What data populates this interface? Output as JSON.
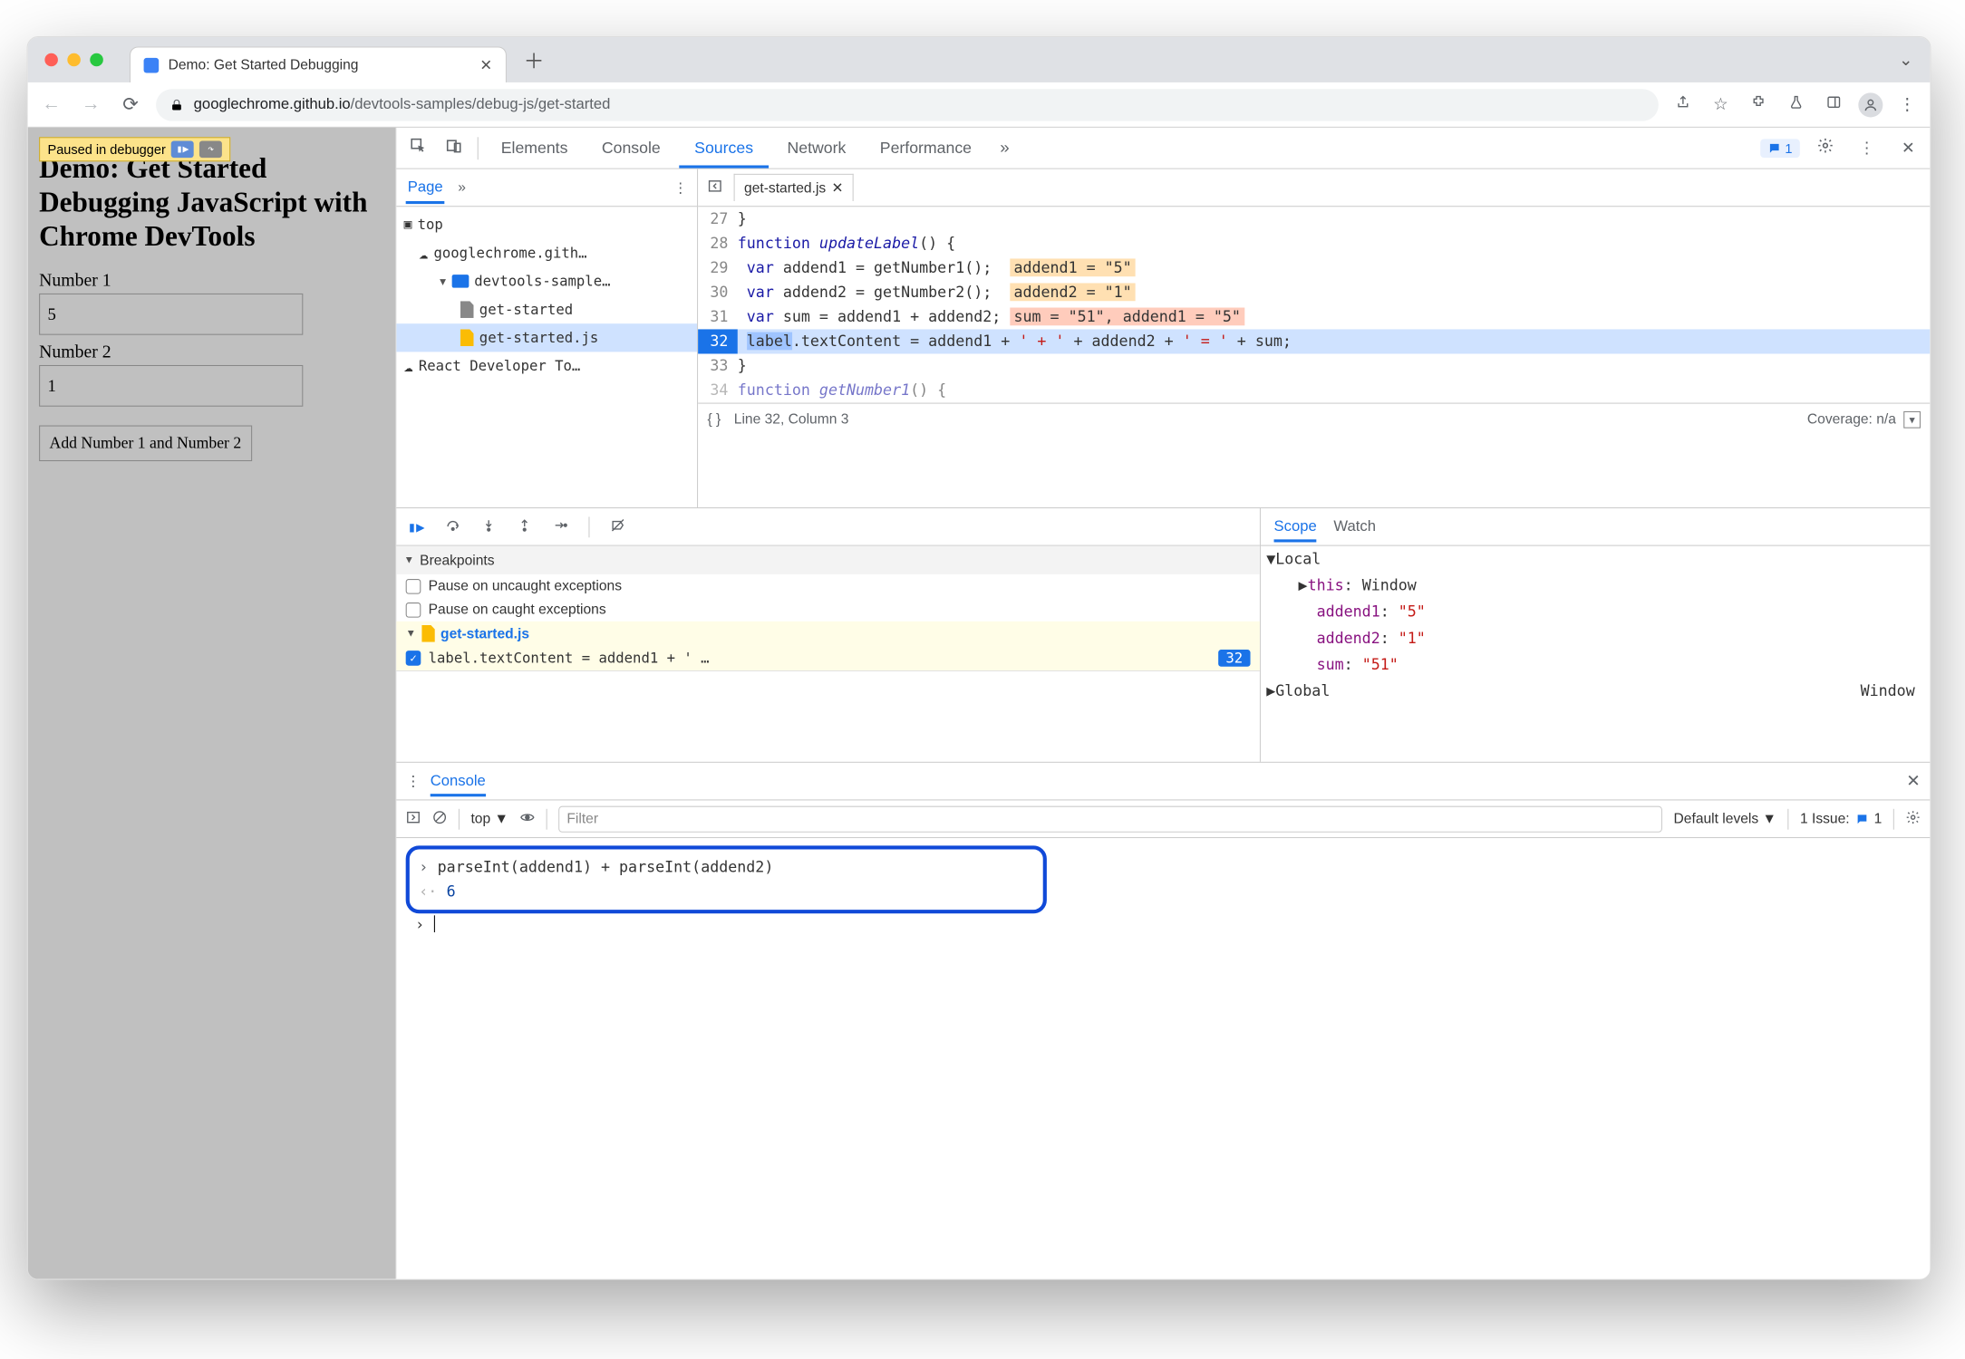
{
  "browser": {
    "tabTitle": "Demo: Get Started Debugging",
    "urlHost": "googlechrome.github.io",
    "urlPath": "/devtools-samples/debug-js/get-started"
  },
  "page": {
    "pausedText": "Paused in debugger",
    "heading": "Demo: Get Started Debugging JavaScript with Chrome DevTools",
    "num1Label": "Number 1",
    "num1Value": "5",
    "num2Label": "Number 2",
    "num2Value": "1",
    "addButton": "Add Number 1 and Number 2"
  },
  "devtools": {
    "tabs": {
      "elements": "Elements",
      "console": "Console",
      "sources": "Sources",
      "network": "Network",
      "performance": "Performance"
    },
    "moreGlyph": "»",
    "issuesCount": "1"
  },
  "navigator": {
    "pageTab": "Page",
    "moreGlyph": "»",
    "items": {
      "top": "top",
      "domain": "googlechrome.gith…",
      "folder": "devtools-sample…",
      "file1": "get-started",
      "file2": "get-started.js",
      "rdt": "React Developer To…"
    }
  },
  "editor": {
    "openFile": "get-started.js",
    "lines": [
      {
        "n": "27",
        "text": "}"
      },
      {
        "n": "28",
        "kw": "function",
        "fn": " updateLabel",
        "rest": "() {"
      },
      {
        "n": "29",
        "kw": "  var",
        "rest": " addend1 = getNumber1();",
        "annot": "addend1 = \"5\""
      },
      {
        "n": "30",
        "kw": "  var",
        "rest": " addend2 = getNumber2();",
        "annot": "addend2 = \"1\""
      },
      {
        "n": "31",
        "kw": "  var",
        "rest": " sum = addend1 + addend2;",
        "annot": "sum = \"51\", addend1 = \"5\""
      },
      {
        "n": "32",
        "exec": true,
        "sel": "label",
        "rest1": ".textContent = addend1 + ",
        "s1": "' + '",
        "rest2": " + addend2 + ",
        "s2": "' = '",
        "rest3": " + sum;"
      },
      {
        "n": "33",
        "text": "}"
      },
      {
        "n": "34",
        "kw": "function",
        "fn": " getNumber1",
        "rest": "() {",
        "cut": true
      }
    ],
    "statusPos": "Line 32, Column 3",
    "coverage": "Coverage: n/a"
  },
  "debug": {
    "breakpointsHd": "Breakpoints",
    "pauseUncaught": "Pause on uncaught exceptions",
    "pauseCaught": "Pause on caught exceptions",
    "bpFile": "get-started.js",
    "bpText": "label.textContent = addend1 + ' …",
    "bpLine": "32",
    "scopeTab": "Scope",
    "watchTab": "Watch",
    "scope": {
      "local": "Local",
      "thisK": "this",
      "thisV": ": Window",
      "a1K": "addend1",
      "a1V": "\"5\"",
      "a2K": "addend2",
      "a2V": "\"1\"",
      "sumK": "sum",
      "sumV": "\"51\"",
      "global": "Global",
      "globalV": "Window"
    }
  },
  "console": {
    "label": "Console",
    "ctx": "top",
    "filterPh": "Filter",
    "levels": "Default levels",
    "issueLabel": "1 Issue:",
    "issueCount": "1",
    "input": "parseInt(addend1) + parseInt(addend2)",
    "output": "6"
  }
}
